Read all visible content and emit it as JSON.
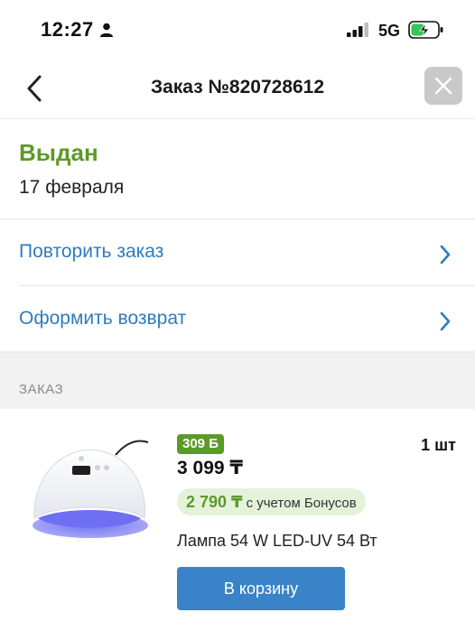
{
  "status_bar": {
    "time": "12:27",
    "network": "5G",
    "icons": [
      "person-icon",
      "signal-icon",
      "battery-charging-icon"
    ]
  },
  "nav": {
    "title": "Заказ №820728612",
    "back_icon": "chevron-left-icon",
    "close_icon": "close-icon"
  },
  "order": {
    "status": "Выдан",
    "status_color": "#5c9a28",
    "date": "17 февраля"
  },
  "actions": [
    {
      "label": "Повторить заказ",
      "icon": "chevron-right-icon"
    },
    {
      "label": "Оформить возврат",
      "icon": "chevron-right-icon"
    }
  ],
  "section": {
    "label": "ЗАКАЗ"
  },
  "product": {
    "bonus_badge": "309 Б",
    "price": "3 099 ₸",
    "quantity": "1 шт",
    "bonus_price": "2 790 ₸",
    "bonus_note": "с учетом Бонусов",
    "name": "Лампа 54 W LED-UV 54 Вт",
    "cart_button": "В корзину",
    "image": "nail-lamp-image"
  },
  "colors": {
    "accent_blue": "#2f7bbd",
    "button_blue": "#3a83c8",
    "green": "#5c9a28",
    "green_light": "#e5f2da"
  }
}
